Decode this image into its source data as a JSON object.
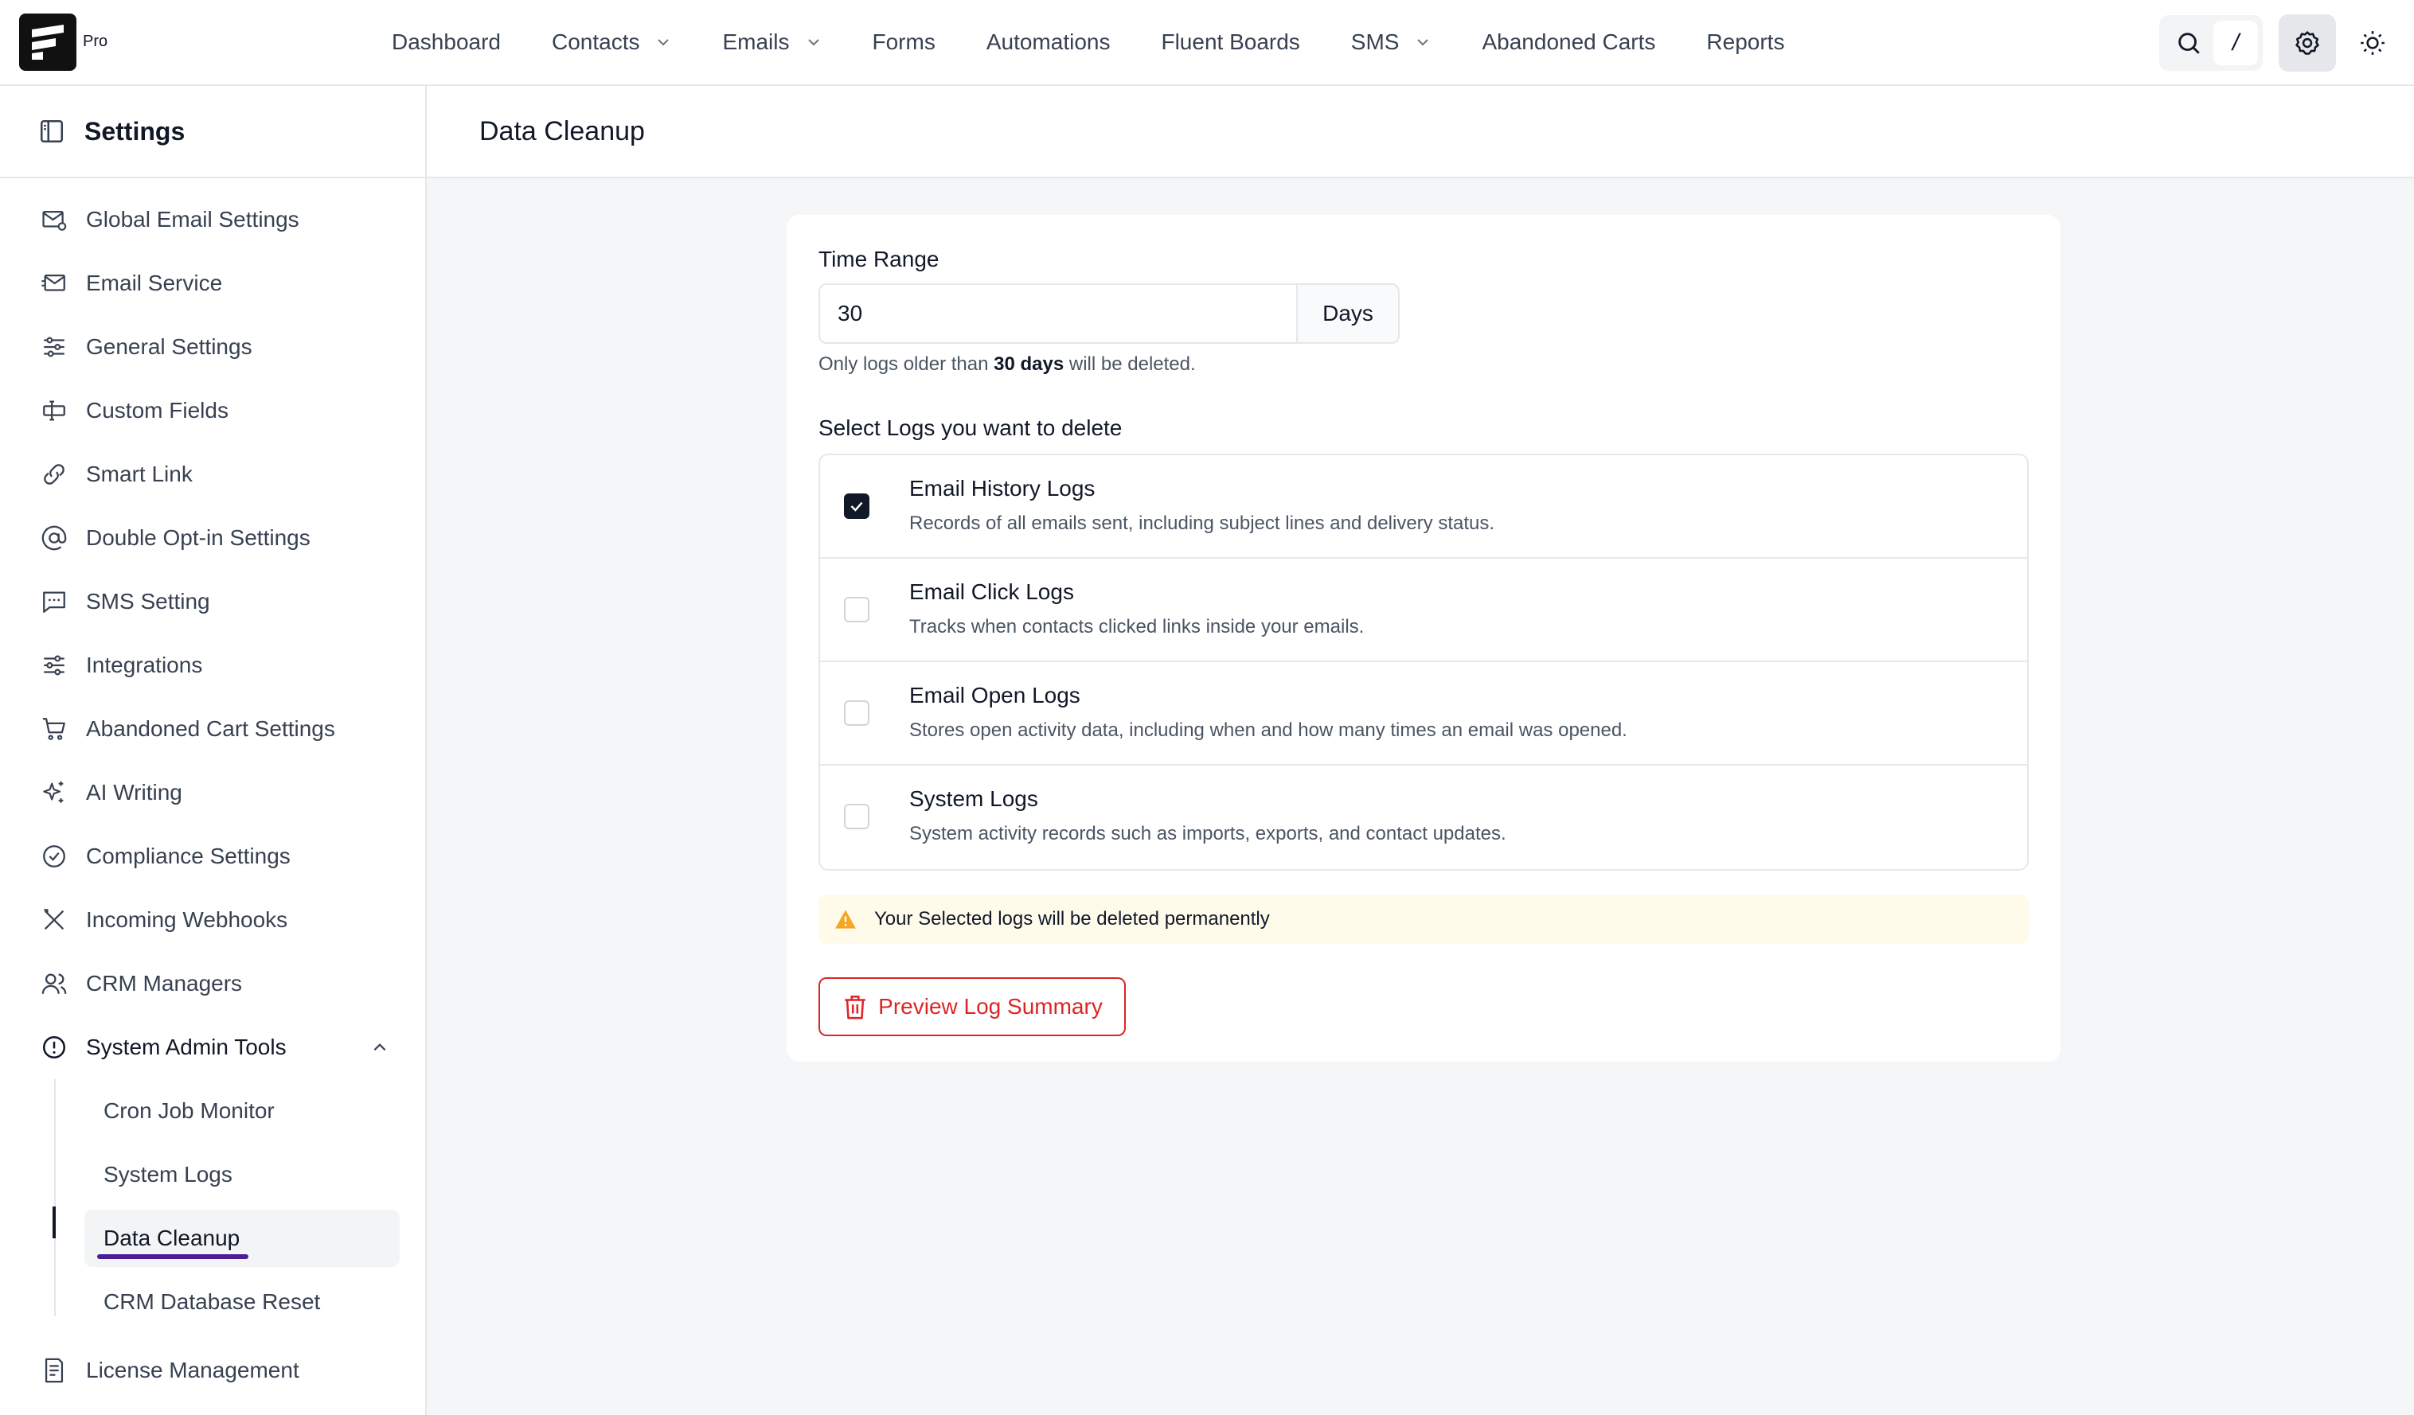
{
  "brand": {
    "badge": "Pro"
  },
  "nav": {
    "items": [
      {
        "label": "Dashboard",
        "has_dropdown": false
      },
      {
        "label": "Contacts",
        "has_dropdown": true
      },
      {
        "label": "Emails",
        "has_dropdown": true
      },
      {
        "label": "Forms",
        "has_dropdown": false
      },
      {
        "label": "Automations",
        "has_dropdown": false
      },
      {
        "label": "Fluent Boards",
        "has_dropdown": false
      },
      {
        "label": "SMS",
        "has_dropdown": true
      },
      {
        "label": "Abandoned Carts",
        "has_dropdown": false
      },
      {
        "label": "Reports",
        "has_dropdown": false
      }
    ],
    "search_shortcut": "/"
  },
  "sidebar": {
    "title": "Settings",
    "items": [
      {
        "label": "Global Email Settings",
        "icon": "mail-settings-icon"
      },
      {
        "label": "Email Service",
        "icon": "mail-send-icon"
      },
      {
        "label": "General Settings",
        "icon": "sliders-icon"
      },
      {
        "label": "Custom Fields",
        "icon": "text-cursor-icon"
      },
      {
        "label": "Smart Link",
        "icon": "link-icon"
      },
      {
        "label": "Double Opt-in Settings",
        "icon": "at-sign-icon"
      },
      {
        "label": "SMS Setting",
        "icon": "message-icon"
      },
      {
        "label": "Integrations",
        "icon": "sliders-icon"
      },
      {
        "label": "Abandoned Cart Settings",
        "icon": "cart-icon"
      },
      {
        "label": "AI Writing",
        "icon": "sparkles-icon"
      },
      {
        "label": "Compliance Settings",
        "icon": "check-circle-icon"
      },
      {
        "label": "Incoming Webhooks",
        "icon": "tools-icon"
      },
      {
        "label": "CRM Managers",
        "icon": "users-icon"
      },
      {
        "label": "System Admin Tools",
        "icon": "alert-circle-icon"
      }
    ],
    "sub_items": [
      {
        "label": "Cron Job Monitor"
      },
      {
        "label": "System Logs"
      },
      {
        "label": "Data Cleanup"
      },
      {
        "label": "CRM Database Reset"
      }
    ],
    "footer_item": {
      "label": "License Management",
      "icon": "document-icon"
    }
  },
  "main": {
    "page_title": "Data Cleanup",
    "time_range": {
      "label": "Time Range",
      "value": "30",
      "suffix": "Days",
      "hint_prefix": "Only logs older than",
      "hint_bold": "30 days",
      "hint_suffix": "will be deleted."
    },
    "logs_label": "Select Logs you want to delete",
    "logs": [
      {
        "title": "Email History Logs",
        "desc": "Records of all emails sent, including subject lines and delivery status.",
        "checked": true
      },
      {
        "title": "Email Click Logs",
        "desc": "Tracks when contacts clicked links inside your emails.",
        "checked": false
      },
      {
        "title": "Email Open Logs",
        "desc": "Stores open activity data, including when and how many times an email was opened.",
        "checked": false
      },
      {
        "title": "System Logs",
        "desc": "System activity records such as imports, exports, and contact updates.",
        "checked": false
      }
    ],
    "warning": "Your Selected logs will be deleted permanently",
    "preview_button": "Preview Log Summary"
  },
  "colors": {
    "danger": "#dc2626",
    "warning_bg": "#fefbeb",
    "warning_icon": "#f5a623",
    "active_underline": "#4c1d95"
  }
}
